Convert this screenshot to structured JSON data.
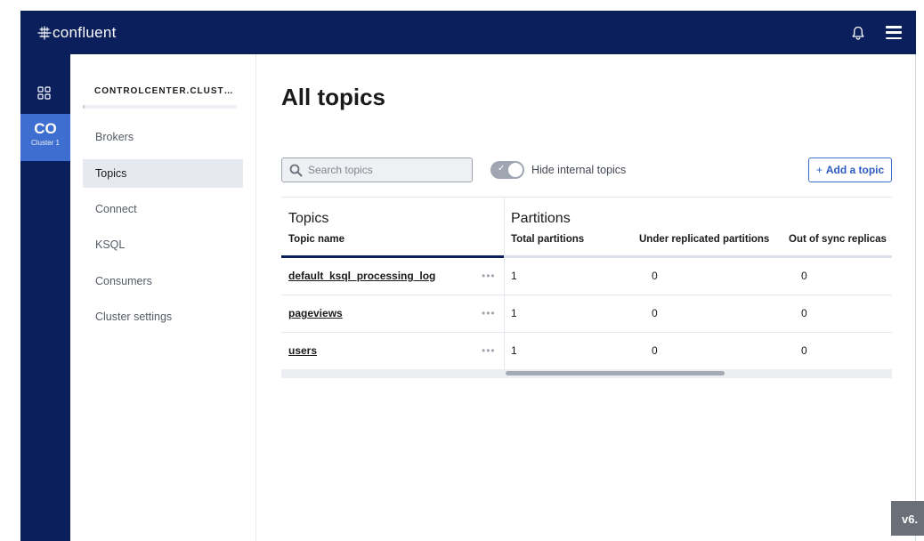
{
  "header": {
    "brand": "confluent"
  },
  "rail": {
    "cluster_abbr": "CO",
    "cluster_label": "Cluster 1"
  },
  "subnav": {
    "cluster_name": "CONTROLCENTER.CLUST…",
    "items": [
      {
        "label": "Brokers"
      },
      {
        "label": "Topics",
        "active": true
      },
      {
        "label": "Connect"
      },
      {
        "label": "KSQL"
      },
      {
        "label": "Consumers"
      },
      {
        "label": "Cluster settings"
      }
    ]
  },
  "main": {
    "title": "All topics",
    "search_placeholder": "Search topics",
    "hide_internal_label": "Hide internal topics",
    "add_topic_label": "Add a topic",
    "add_topic_prefix": "+"
  },
  "table": {
    "group_topics": "Topics",
    "group_partitions": "Partitions",
    "columns": [
      "Topic name",
      "Total partitions",
      "Under replicated partitions",
      "Out of sync replicas"
    ],
    "rows": [
      {
        "name": "default_ksql_processing_log",
        "total": "1",
        "under": "0",
        "out_of_sync": "0"
      },
      {
        "name": "pageviews",
        "total": "1",
        "under": "0",
        "out_of_sync": "0"
      },
      {
        "name": "users",
        "total": "1",
        "under": "0",
        "out_of_sync": "0"
      }
    ],
    "row_menu": "•••"
  },
  "version": "v6.",
  "colors": {
    "nav_bg": "#0a1f5c",
    "accent": "#3e6fd0",
    "active_item_bg": "#e6eaf0"
  }
}
